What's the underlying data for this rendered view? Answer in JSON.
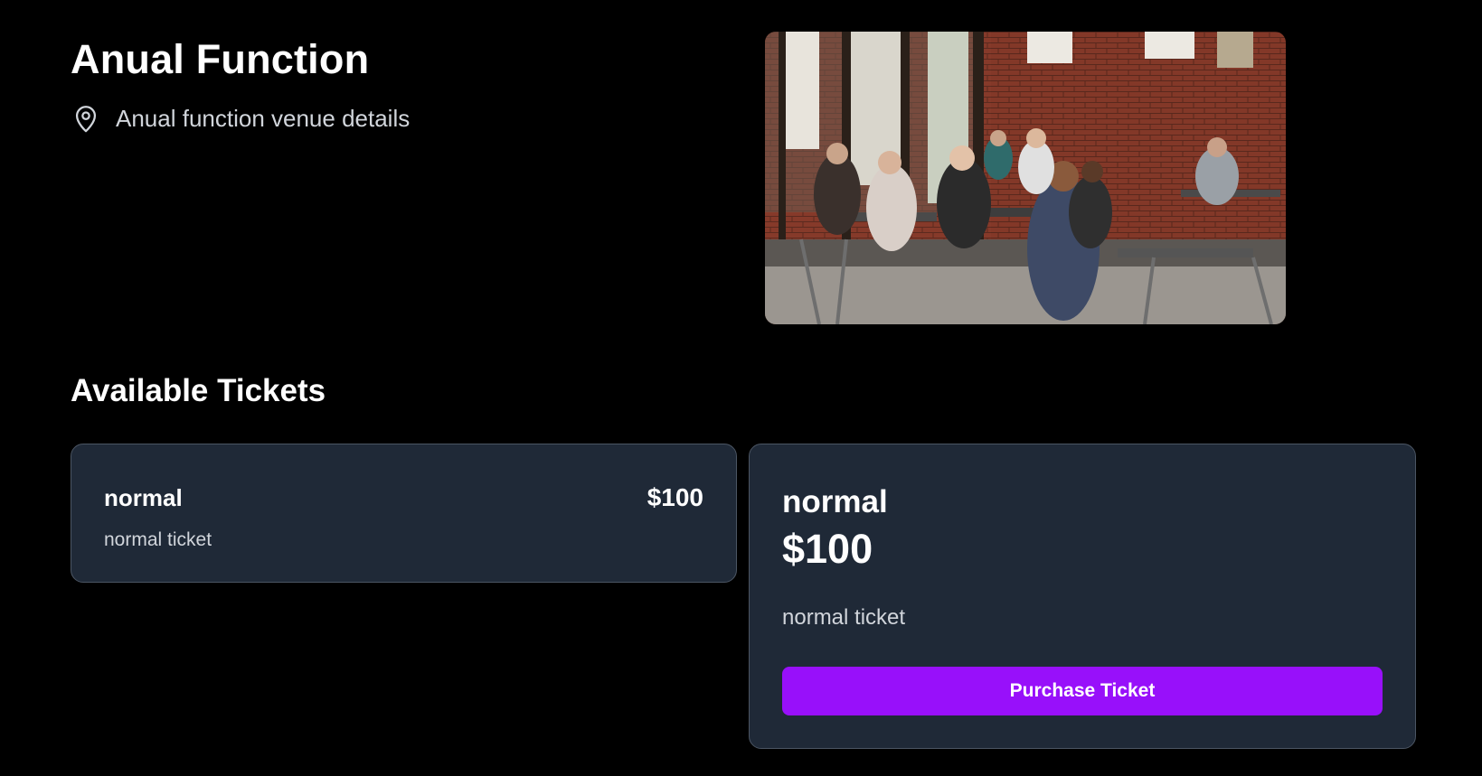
{
  "event": {
    "title": "Anual Function",
    "venue": "Anual function venue details",
    "venue_icon": "map-pin-icon",
    "image_alt": "cafe-interior-photo"
  },
  "tickets_section": {
    "title": "Available Tickets"
  },
  "ticket_list": [
    {
      "name": "normal",
      "price": "$100",
      "description": "normal ticket"
    }
  ],
  "ticket_detail": {
    "name": "normal",
    "price": "$100",
    "description": "normal ticket",
    "purchase_label": "Purchase Ticket"
  },
  "colors": {
    "background": "#000000",
    "card": "#1f2937",
    "card_border": "#4b5563",
    "accent": "#9810fa",
    "muted_text": "#d1d5db"
  }
}
